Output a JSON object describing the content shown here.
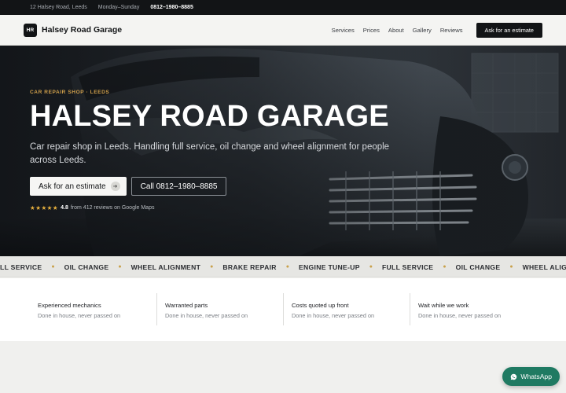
{
  "topbar": {
    "address": "12 Halsey Road, Leeds",
    "hours": "Monday–Sunday",
    "phone": "0812–1980–8885"
  },
  "nav": {
    "logo_mark": "HR",
    "logo_name": "Halsey Road Garage",
    "links": [
      "Services",
      "Prices",
      "About",
      "Gallery",
      "Reviews"
    ],
    "cta": "Ask for an estimate"
  },
  "hero": {
    "eyebrow": "CAR REPAIR SHOP · LEEDS",
    "title": "HALSEY ROAD GARAGE",
    "subtitle": "Car repair shop in Leeds. Handling full service, oil change and wheel alignment for people across Leeds.",
    "primary_button": "Ask for an estimate",
    "primary_button_icon": "arrow-right-icon",
    "secondary_button": "Call 0812–1980–8885",
    "rating": {
      "stars": "★★★★★",
      "score": "4.8",
      "text": "from 412 reviews on Google Maps"
    }
  },
  "ticker": {
    "items": [
      "FULL SERVICE",
      "OIL CHANGE",
      "WHEEL ALIGNMENT",
      "BRAKE REPAIR",
      "ENGINE TUNE-UP",
      "FULL SERVICE",
      "OIL CHANGE",
      "WHEEL ALIGNMENT"
    ],
    "separator_color": "#c9a14a"
  },
  "features": [
    {
      "title": "Experienced mechanics",
      "subtitle": "Done in house, never passed on"
    },
    {
      "title": "Warranted parts",
      "subtitle": "Done in house, never passed on"
    },
    {
      "title": "Costs quoted up front",
      "subtitle": "Done in house, never passed on"
    },
    {
      "title": "Wait while we work",
      "subtitle": "Done in house, never passed on"
    }
  ],
  "whatsapp": {
    "label": "WhatsApp",
    "icon": "whatsapp-icon",
    "color": "#1f7a62"
  },
  "colors": {
    "accent": "#d1a04b",
    "dark": "#121416",
    "star": "#e7b03d"
  }
}
